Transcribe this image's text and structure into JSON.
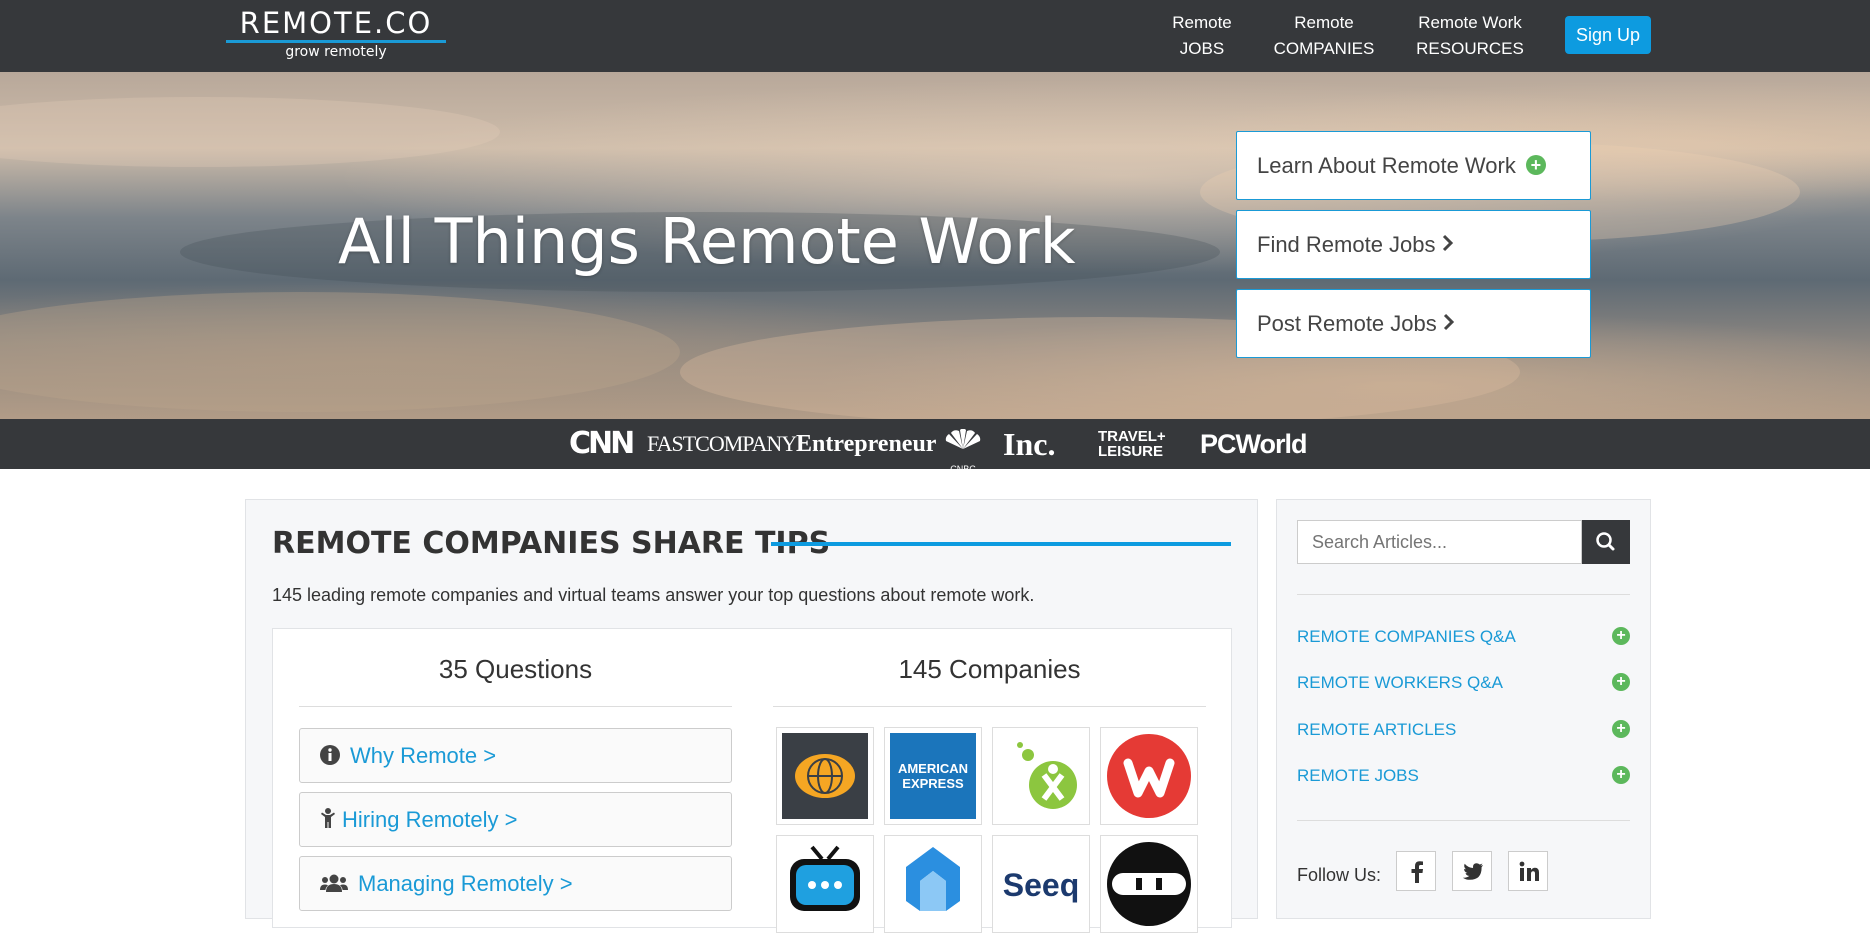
{
  "header": {
    "logo_text": "REMOTE.CO",
    "logo_tagline": "grow remotely",
    "nav": [
      {
        "line1": "Remote",
        "line2": "JOBS"
      },
      {
        "line1": "Remote",
        "line2": "COMPANIES"
      },
      {
        "line1": "Remote Work",
        "line2": "RESOURCES"
      }
    ],
    "signup_label": "Sign Up"
  },
  "hero": {
    "title": "All Things Remote Work",
    "buttons": [
      {
        "label": "Learn About Remote Work",
        "icon": "plus-circle-icon"
      },
      {
        "label": "Find Remote Jobs",
        "icon": "chevron-right-icon"
      },
      {
        "label": "Post Remote Jobs",
        "icon": "chevron-right-icon"
      }
    ]
  },
  "press": {
    "logos": [
      "CNN",
      "FASTCOMPANY",
      "Entrepreneur",
      "CNBC",
      "Inc.",
      "TRAVEL+ LEISURE",
      "PCWorld"
    ]
  },
  "main": {
    "title": "REMOTE COMPANIES SHARE TIPS",
    "description": "145 leading remote companies and virtual teams answer your top questions about remote work.",
    "questions_heading": "35 Questions",
    "companies_heading": "145 Companies",
    "questions": [
      {
        "label": "Why Remote >",
        "icon": "info-circle-icon"
      },
      {
        "label": "Hiring Remotely >",
        "icon": "child-figure-icon"
      },
      {
        "label": "Managing Remotely >",
        "icon": "users-icon"
      }
    ],
    "companies": [
      {
        "name": "globe-planet-logo",
        "color": "#3a3f45"
      },
      {
        "name": "AMERICAN EXPRESS",
        "color": "#1b75bb"
      },
      {
        "name": "green-figure-logo",
        "color": "#8cc63f"
      },
      {
        "name": "red-w-logo",
        "color": "#e53a35"
      },
      {
        "name": "blue-tv-chat-logo",
        "color": "#1fa0e0"
      },
      {
        "name": "blue-shape-logo",
        "color": "#2b8fe0"
      },
      {
        "name": "Seeq",
        "color": "#1c3a6e"
      },
      {
        "name": "ninja-logo",
        "color": "#111111"
      }
    ]
  },
  "sidebar": {
    "search_placeholder": "Search Articles...",
    "links": [
      "REMOTE COMPANIES Q&A",
      "REMOTE WORKERS Q&A",
      "REMOTE ARTICLES",
      "REMOTE JOBS"
    ],
    "follow_label": "Follow Us:",
    "social": [
      "facebook-icon",
      "twitter-icon",
      "linkedin-icon"
    ]
  },
  "colors": {
    "nav_bg": "#36383b",
    "accent_blue": "#0d9be0",
    "plus_green": "#5cb85c",
    "link_blue": "#1a9ad6"
  }
}
